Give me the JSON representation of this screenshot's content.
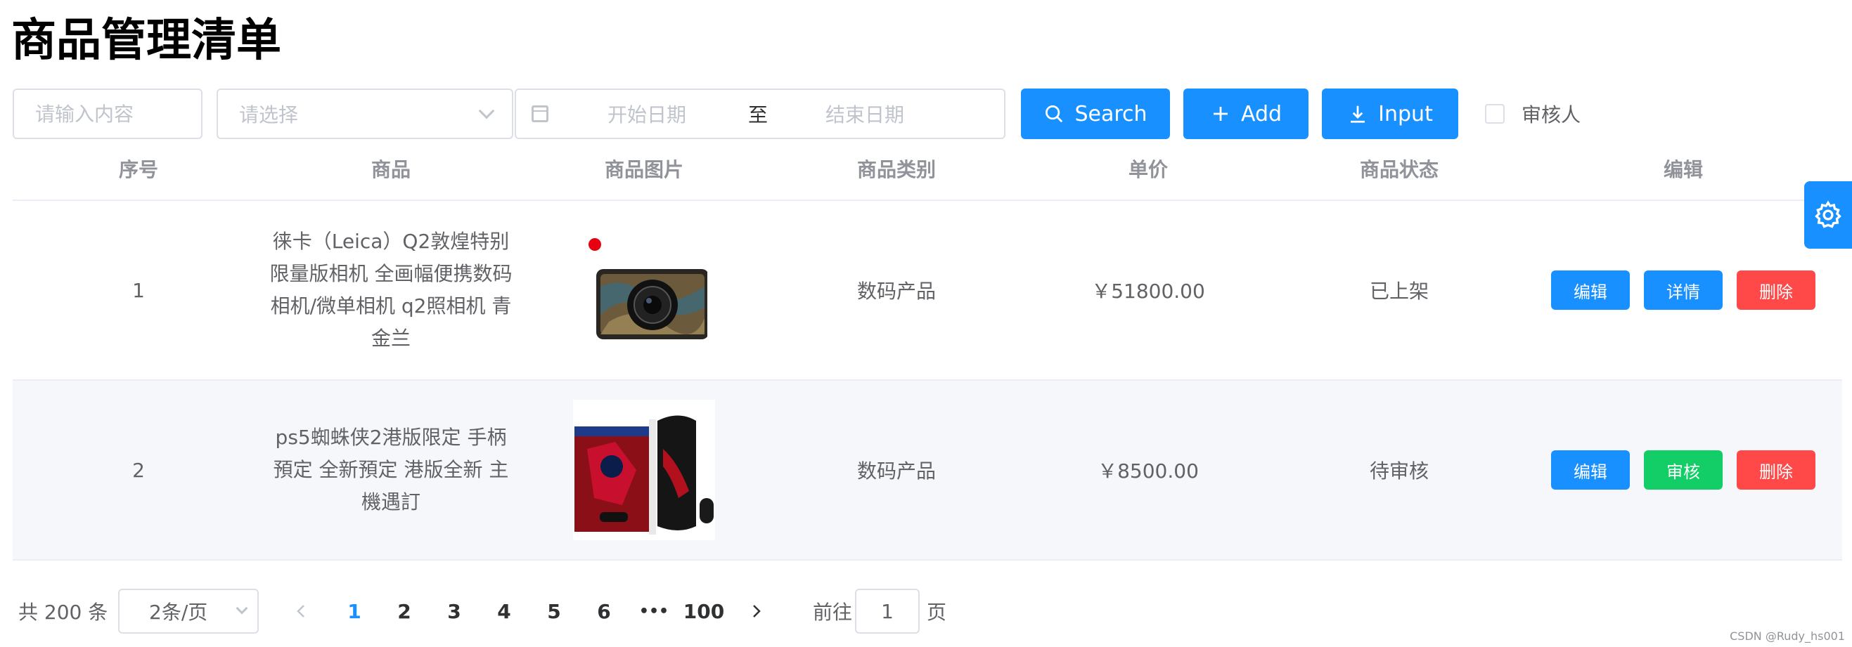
{
  "page_title": "商品管理清单",
  "filters": {
    "keyword_placeholder": "请输入内容",
    "select_placeholder": "请选择",
    "date_start_placeholder": "开始日期",
    "date_separator": "至",
    "date_end_placeholder": "结束日期"
  },
  "toolbar": {
    "search_label": "Search",
    "add_label": "Add",
    "input_label": "Input",
    "reviewer_label": "审核人"
  },
  "table": {
    "headers": [
      "序号",
      "商品",
      "商品图片",
      "商品类别",
      "单价",
      "商品状态",
      "编辑"
    ],
    "rows": [
      {
        "index": "1",
        "name": "徕卡（Leica）Q2敦煌特别限量版相机 全画幅便携数码相机/微单相机 q2照相机 青金兰",
        "category": "数码产品",
        "price": "￥51800.00",
        "status": "已上架",
        "actions": [
          "编辑",
          "详情",
          "删除"
        ]
      },
      {
        "index": "2",
        "name": "ps5蜘蛛侠2港版限定 手柄預定 全新預定 港版全新 主機遇訂",
        "category": "数码产品",
        "price": "￥8500.00",
        "status": "待审核",
        "actions": [
          "编辑",
          "审核",
          "删除"
        ]
      }
    ]
  },
  "pagination": {
    "total_text": "共 200 条",
    "page_size": "2条/页",
    "pages": [
      "1",
      "2",
      "3",
      "4",
      "5",
      "6"
    ],
    "ellipsis": "•••",
    "last_page": "100",
    "goto_label": "前往",
    "goto_value": "1",
    "goto_suffix": "页",
    "current_page": 1
  },
  "watermark": "CSDN @Rudy_hs001",
  "colors": {
    "primary": "#1890ff",
    "success": "#13ce66",
    "danger": "#ff4949",
    "row_alt": "#f5f7fa"
  },
  "icons": [
    "search-icon",
    "plus-icon",
    "download-icon",
    "calendar-icon",
    "chevron-down-icon",
    "gear-icon",
    "chevron-left-icon",
    "chevron-right-icon"
  ]
}
